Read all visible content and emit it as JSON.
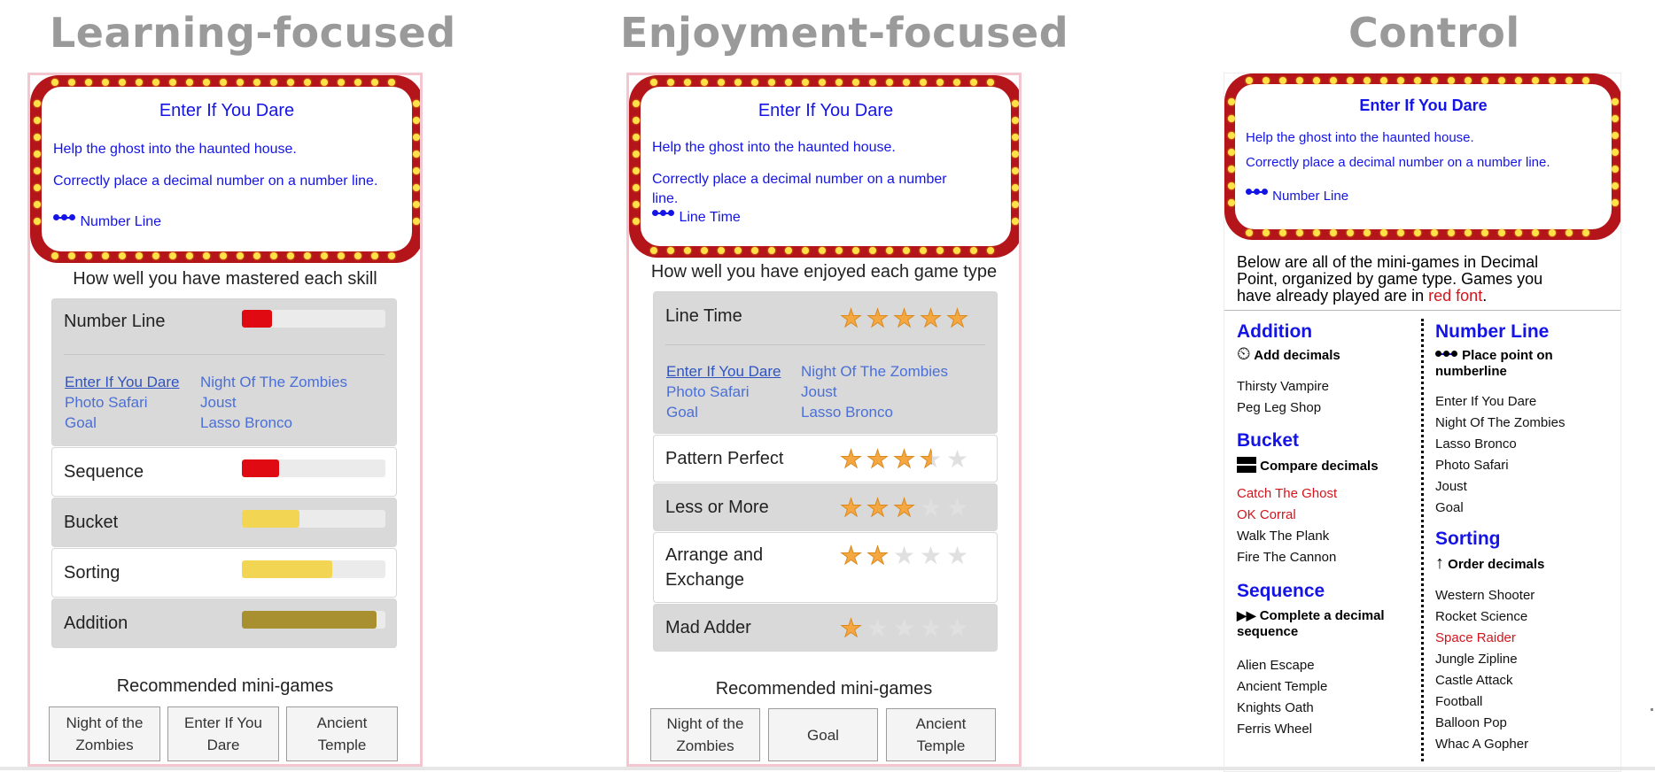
{
  "columns": {
    "learning": "Learning-focused",
    "enjoyment": "Enjoyment-focused",
    "control": "Control"
  },
  "marquee": {
    "title": "Enter If You Dare",
    "line1": "Help the ghost into the haunted house.",
    "line2": "Correctly place a decimal number on a number line.",
    "line2_a": "Correctly place a decimal number on a number",
    "line2_b": "line.",
    "skill_learning": "Number Line",
    "skill_enjoyment": "Line Time",
    "skill_control": "Number Line"
  },
  "learning": {
    "heading": "How well you have mastered each skill",
    "skills": [
      {
        "label": "Number Line",
        "mastery": 0.21,
        "color": "#e00b12"
      },
      {
        "label": "Sequence",
        "mastery": 0.26,
        "color": "#e00b12"
      },
      {
        "label": "Bucket",
        "mastery": 0.4,
        "color": "#f2d553"
      },
      {
        "label": "Sorting",
        "mastery": 0.63,
        "color": "#f2d553"
      },
      {
        "label": "Addition",
        "mastery": 0.94,
        "color": "#a88f30"
      }
    ],
    "games": [
      "Enter If You Dare",
      "Night Of The Zombies",
      "Photo Safari",
      "Joust",
      "Goal",
      "Lasso Bronco"
    ],
    "recommended_heading": "Recommended mini-games",
    "recommended": [
      {
        "l1": "Night of the",
        "l2": "Zombies"
      },
      {
        "l1": "Enter If You",
        "l2": "Dare"
      },
      {
        "l1": "Ancient",
        "l2": "Temple"
      }
    ]
  },
  "enjoyment": {
    "heading": "How well you have enjoyed each game type",
    "types": [
      {
        "label": "Line Time",
        "rating": 5
      },
      {
        "label": "Pattern Perfect",
        "rating": 3.5
      },
      {
        "label": "Less or More",
        "rating": 3
      },
      {
        "label_1": "Arrange and",
        "label_2": "Exchange",
        "rating": 2
      },
      {
        "label": "Mad Adder",
        "rating": 1
      }
    ],
    "games": [
      "Enter If You Dare",
      "Night Of The Zombies",
      "Photo Safari",
      "Joust",
      "Goal",
      "Lasso Bronco"
    ],
    "recommended_heading": "Recommended mini-games",
    "recommended": [
      {
        "l1": "Night of the",
        "l2": "Zombies"
      },
      {
        "l1": "Goal"
      },
      {
        "l1": "Ancient",
        "l2": "Temple"
      }
    ]
  },
  "control": {
    "desc_1": "Below are all of the mini-games in Decimal",
    "desc_2": "Point, organized by game type. Games you",
    "desc_3": "have already played are in",
    "desc_red": "red font",
    "desc_end": ".",
    "categories": {
      "addition": {
        "name": "Addition",
        "sub": "Add decimals",
        "items": [
          "Thirsty Vampire",
          "Peg Leg Shop"
        ]
      },
      "bucket": {
        "name": "Bucket",
        "sub": "Compare decimals",
        "items": [
          "Catch The Ghost",
          "OK Corral",
          "Walk The Plank",
          "Fire The Cannon"
        ]
      },
      "sequence": {
        "name": "Sequence",
        "sub_1": "Complete a decimal",
        "sub_2": "sequence",
        "items": [
          "Alien Escape",
          "Ancient Temple",
          "Knights Oath",
          "Ferris Wheel"
        ]
      },
      "numberline": {
        "name": "Number Line",
        "sub_1": "Place point on",
        "sub_2": "numberline",
        "items": [
          "Enter If You Dare",
          "Night Of The Zombies",
          "Lasso Bronco",
          "Photo Safari",
          "Joust",
          "Goal"
        ]
      },
      "sorting": {
        "name": "Sorting",
        "sub": "Order decimals",
        "items": [
          "Western Shooter",
          "Rocket Science",
          "Space Raider",
          "Jungle Zipline",
          "Castle Attack",
          "Football",
          "Balloon Pop",
          "Whac A Gopher"
        ]
      }
    },
    "played_color": "#d4141c"
  },
  "colors": {
    "marquee_frame": "#b3151b",
    "marquee_text": "#1414e6",
    "star_on": "#f5a742",
    "category_blue": "#1414e6"
  }
}
